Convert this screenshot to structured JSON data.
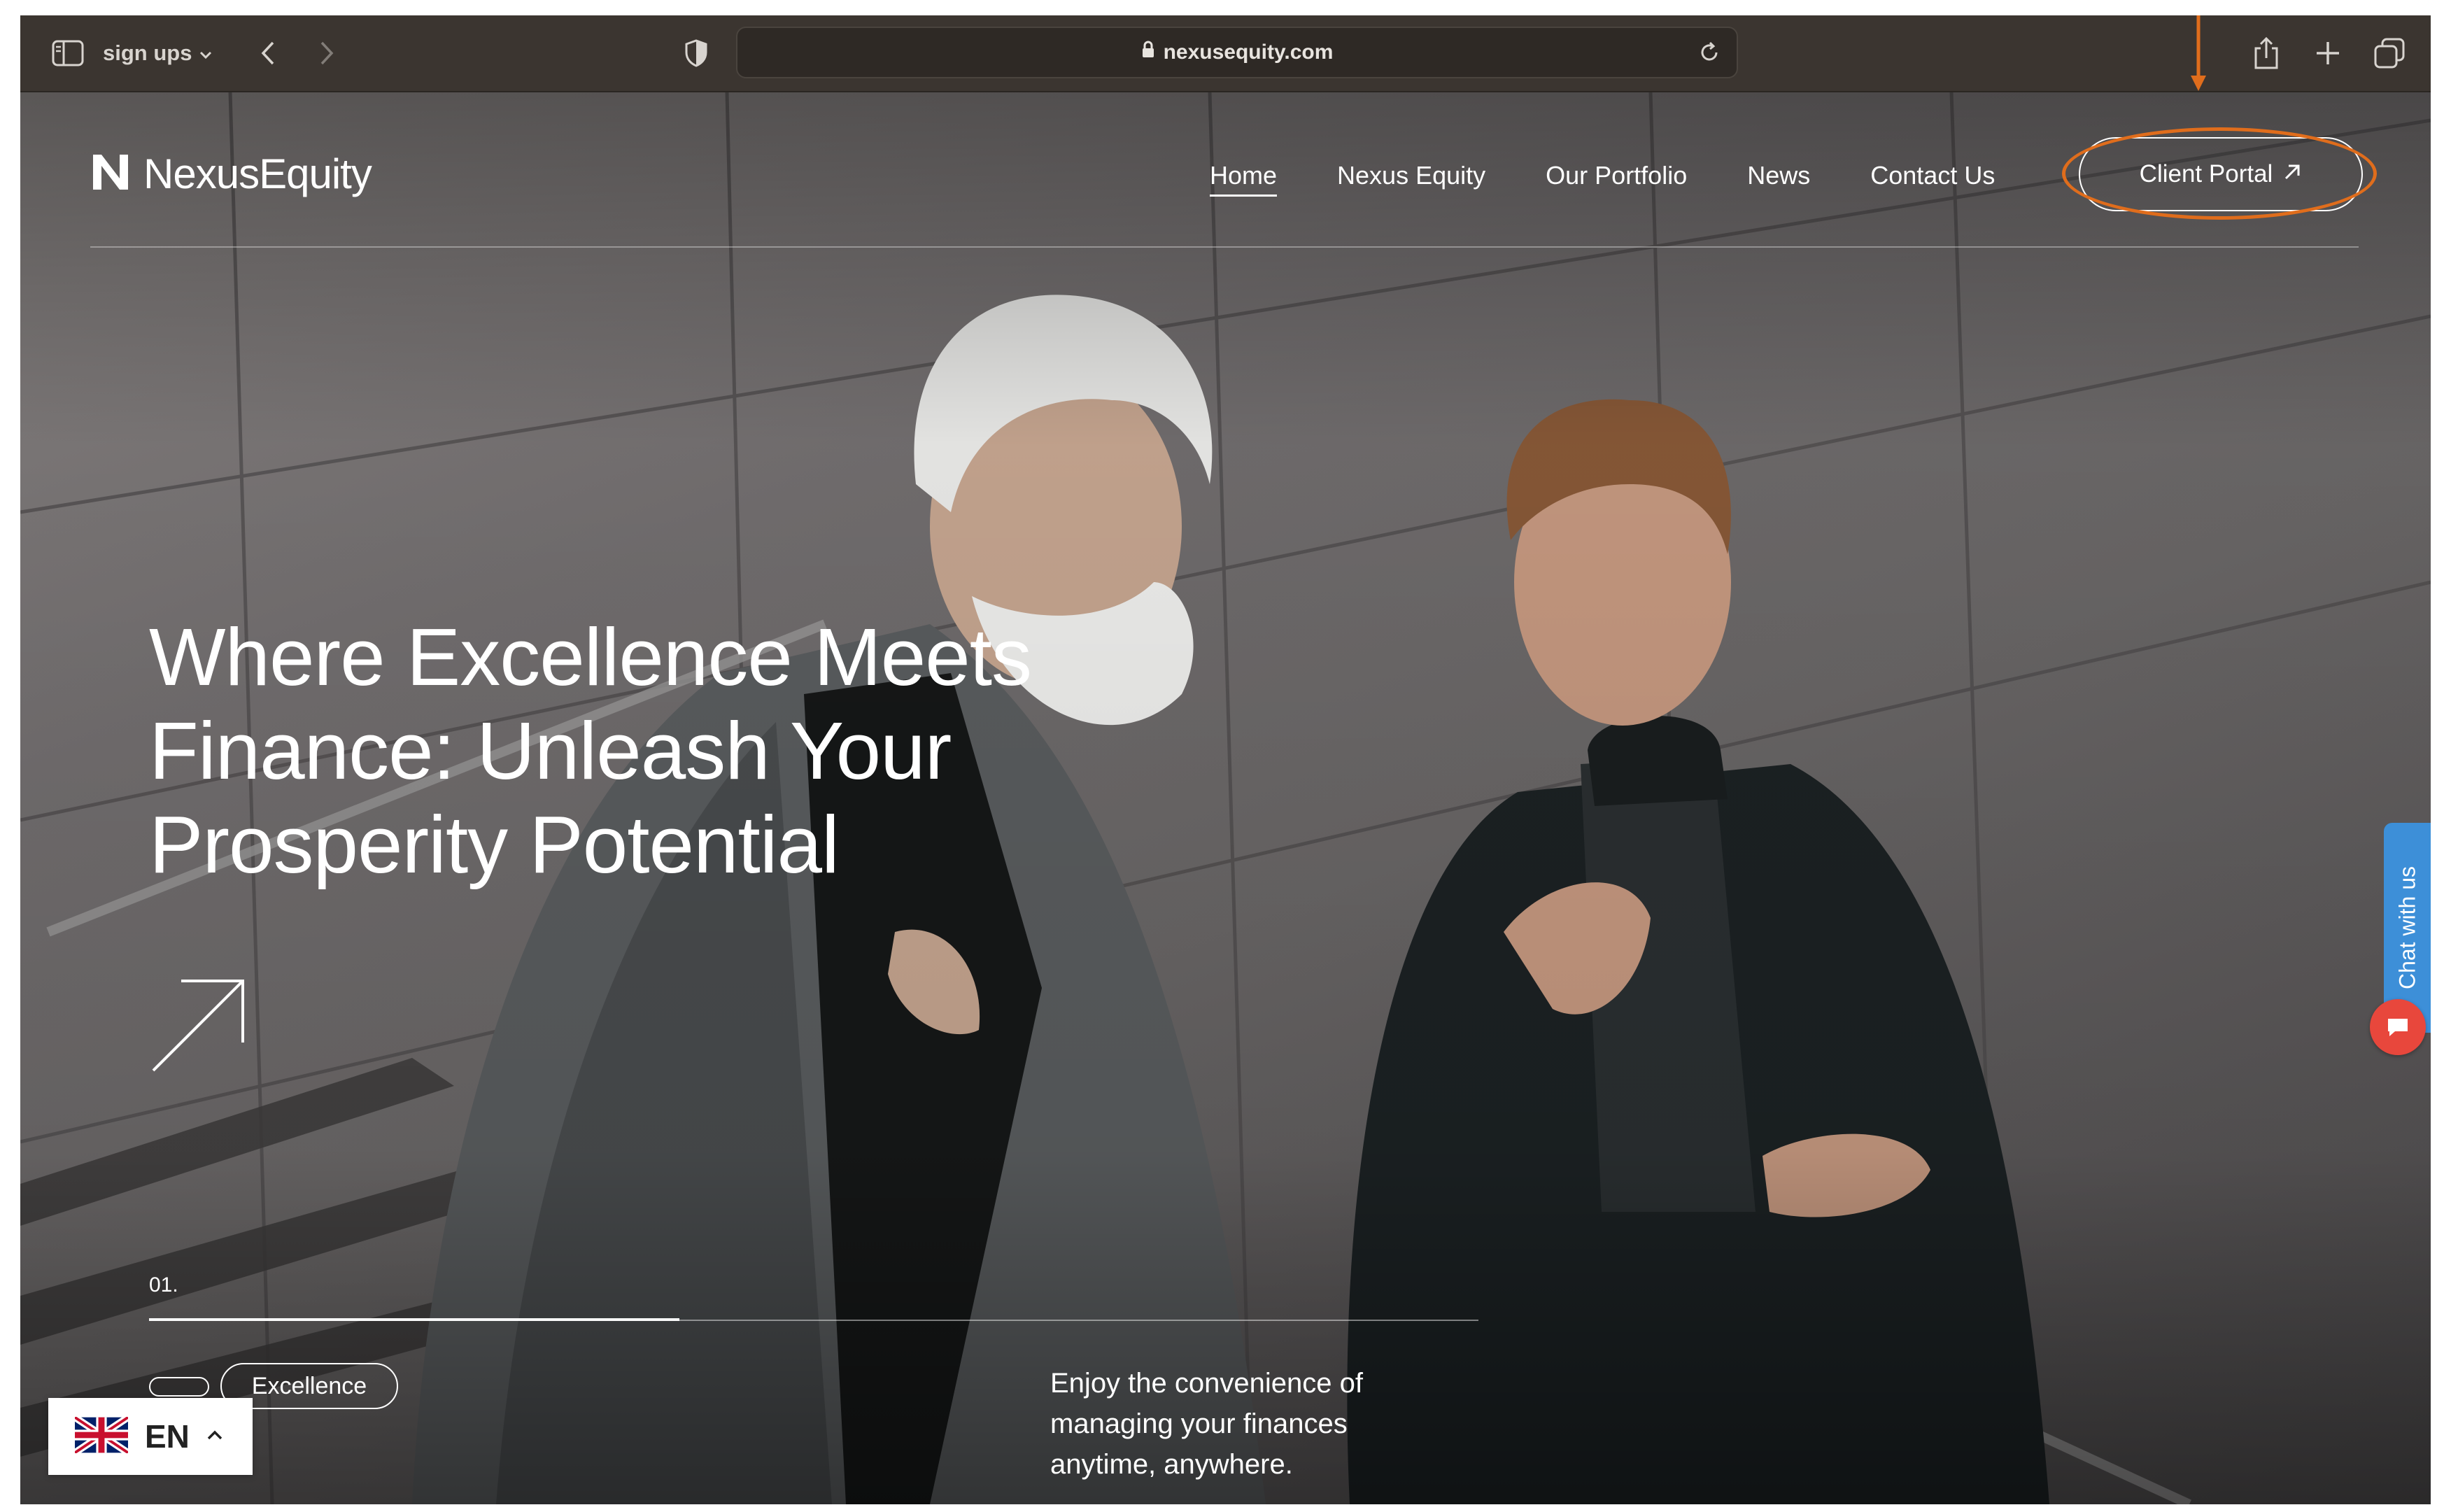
{
  "browser": {
    "tab_group": "sign ups",
    "url": "nexusequity.com"
  },
  "site": {
    "logo_text": "NexusEquity",
    "nav": [
      "Home",
      "Nexus Equity",
      "Our Portfolio",
      "News",
      "Contact Us"
    ],
    "active_nav": "Home",
    "client_portal_label": "Client Portal"
  },
  "hero": {
    "headline_lines": [
      "Where Excellence Meets",
      "Finance: Unleash Your",
      "Prosperity Potential"
    ],
    "slide_number": "01.",
    "pill_label": "Excellence",
    "tagline_lines": [
      "Enjoy the convenience of",
      "managing your finances",
      "anytime, anywhere."
    ]
  },
  "chat": {
    "label": "Chat with us"
  },
  "language": {
    "code": "EN"
  },
  "colors": {
    "annotation_orange": "#e06d1c",
    "chat_blue": "#3d8fd8",
    "chat_red": "#e8473c",
    "toolbar": "#3b3530"
  },
  "icons": [
    "sidebar-icon",
    "chevron-down-icon",
    "back-arrow-icon",
    "forward-arrow-icon",
    "shield-icon",
    "lock-icon",
    "reload-icon",
    "share-icon",
    "plus-icon",
    "tabs-icon",
    "arrow-up-right-icon",
    "chat-icon",
    "uk-flag-icon",
    "chevron-up-icon"
  ]
}
